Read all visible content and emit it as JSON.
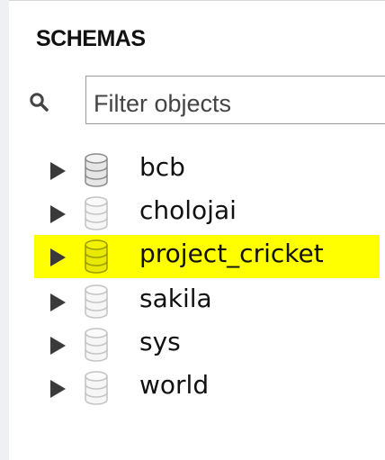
{
  "panel": {
    "title": "SCHEMAS",
    "filter": {
      "placeholder": "Filter objects",
      "value": ""
    },
    "schemas": [
      {
        "name": "bcb",
        "selected": false,
        "icon": "database-icon-gray"
      },
      {
        "name": "cholojai",
        "selected": false,
        "icon": "database-icon-light"
      },
      {
        "name": "project_cricket",
        "selected": true,
        "icon": "database-icon-highlighted"
      },
      {
        "name": "sakila",
        "selected": false,
        "icon": "database-icon-light"
      },
      {
        "name": "sys",
        "selected": false,
        "icon": "database-icon-light"
      },
      {
        "name": "world",
        "selected": false,
        "icon": "database-icon-light"
      }
    ]
  },
  "colors": {
    "highlight": "#ffff00",
    "arrow": "#3a3a3a"
  }
}
